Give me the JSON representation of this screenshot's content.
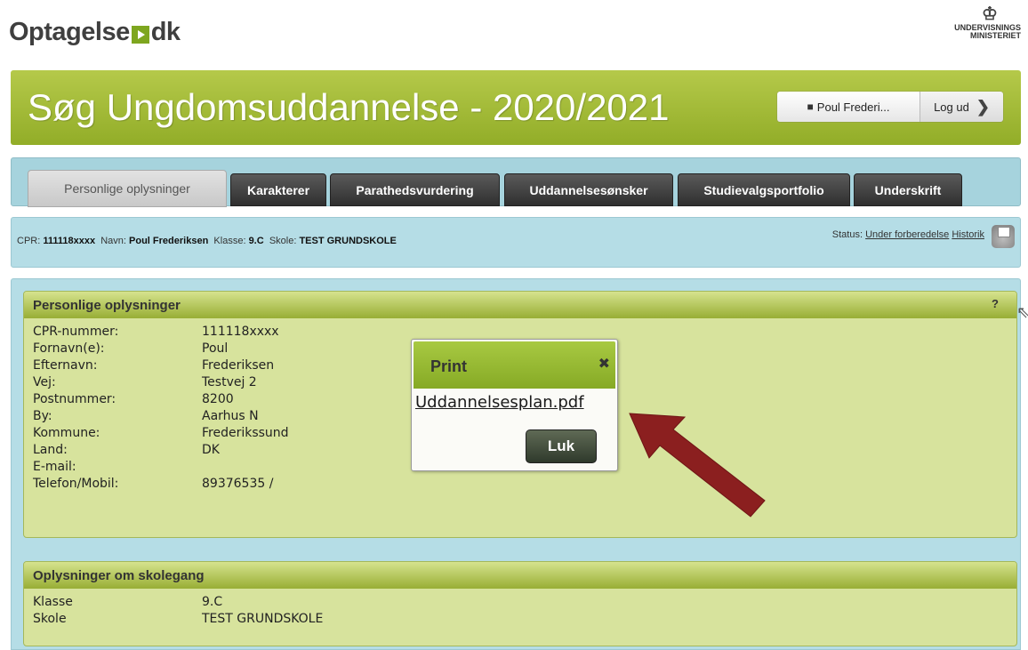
{
  "brand": {
    "left": "Optagelse",
    "right": "dk"
  },
  "ministry": {
    "line1": "UNDERVISNINGS",
    "line2": "MINISTERIET"
  },
  "header": {
    "title": "Søg Ungdomsuddannelse - 2020/2021",
    "user_label": "Poul Frederi...",
    "logout_label": "Log ud"
  },
  "tabs": [
    {
      "label": "Personlige oplysninger",
      "active": true
    },
    {
      "label": "Karakterer"
    },
    {
      "label": "Parathedsvurdering"
    },
    {
      "label": "Uddannelsesønsker"
    },
    {
      "label": "Studievalgsportfolio"
    },
    {
      "label": "Underskrift"
    }
  ],
  "infobar": {
    "cpr_label": "CPR:",
    "cpr_value": "111118xxxx",
    "name_label": "Navn:",
    "name_value": "Poul Frederiksen",
    "class_label": "Klasse:",
    "class_value": "9.C",
    "school_label": "Skole:",
    "school_value": "TEST GRUNDSKOLE",
    "status_label": "Status:",
    "status_value": "Under forberedelse",
    "history_label": "Historik"
  },
  "personal": {
    "heading": "Personlige oplysninger",
    "help": "?",
    "rows": [
      {
        "k": "CPR-nummer:",
        "v": "111118xxxx"
      },
      {
        "k": "Fornavn(e):",
        "v": "Poul"
      },
      {
        "k": "Efternavn:",
        "v": "Frederiksen"
      },
      {
        "k": "Vej:",
        "v": "Testvej 2"
      },
      {
        "k": "Postnummer:",
        "v": "8200"
      },
      {
        "k": "By:",
        "v": "Aarhus N"
      },
      {
        "k": "Kommune:",
        "v": "Frederikssund"
      },
      {
        "k": "Land:",
        "v": "DK"
      },
      {
        "k": "E-mail:",
        "v": ""
      },
      {
        "k": "Telefon/Mobil:",
        "v": "89376535 /"
      }
    ]
  },
  "school": {
    "heading": "Oplysninger om skolegang",
    "rows": [
      {
        "k": "Klasse",
        "v": "9.C"
      },
      {
        "k": "Skole",
        "v": "TEST GRUNDSKOLE"
      }
    ]
  },
  "dialog": {
    "title": "Print",
    "close_glyph": "✖",
    "link": "Uddannelsesplan.pdf",
    "close_button": "Luk"
  },
  "colors": {
    "header_green": "#9cb530",
    "tab_dark": "#3a3a3a",
    "panel_bg": "#d7e39d",
    "info_bg": "#b5dde6",
    "arrow_red": "#8b1f1f"
  }
}
